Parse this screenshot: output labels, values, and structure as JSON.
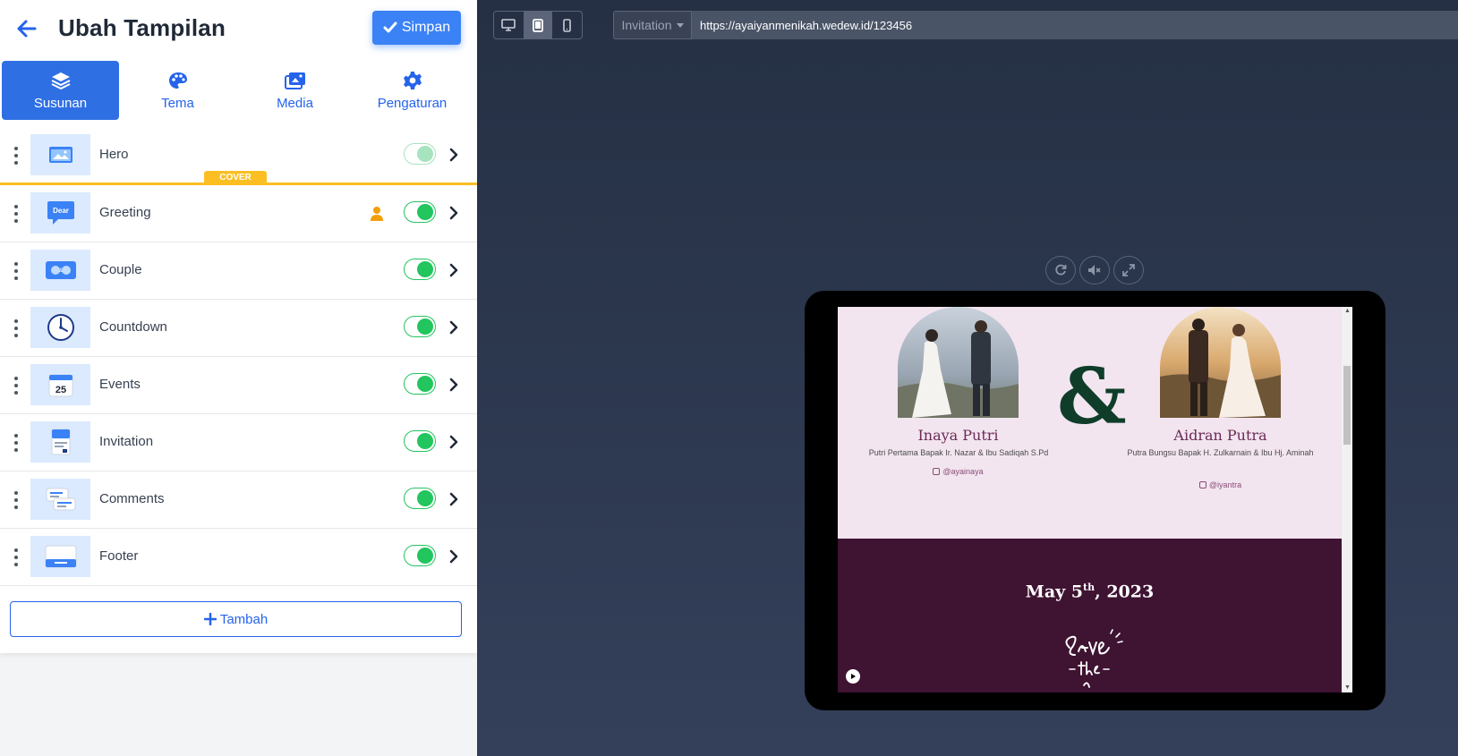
{
  "header": {
    "title": "Ubah Tampilan",
    "save_label": "Simpan"
  },
  "tabs": [
    {
      "label": "Susunan",
      "icon": "layers-icon",
      "active": true
    },
    {
      "label": "Tema",
      "icon": "palette-icon",
      "active": false
    },
    {
      "label": "Media",
      "icon": "images-icon",
      "active": false
    },
    {
      "label": "Pengaturan",
      "icon": "gear-icon",
      "active": false
    }
  ],
  "sections": [
    {
      "label": "Hero",
      "enabled": true,
      "badge": "COVER"
    },
    {
      "label": "Greeting",
      "enabled": true
    },
    {
      "label": "Couple",
      "enabled": true
    },
    {
      "label": "Countdown",
      "enabled": true
    },
    {
      "label": "Events",
      "enabled": true,
      "thumb_text": "25"
    },
    {
      "label": "Invitation",
      "enabled": true
    },
    {
      "label": "Comments",
      "enabled": true
    },
    {
      "label": "Footer",
      "enabled": true
    }
  ],
  "greeting_thumb_text": "Dear",
  "add_label": "Tambah",
  "preview": {
    "page_select": "Invitation",
    "url": "https://ayaiyanmenikah.wedew.id/123456",
    "device": "tablet",
    "bride": {
      "name": "Inaya Putri",
      "desc": "Putri Pertama Bapak Ir. Nazar & Ibu Sadiqah S.Pd",
      "instagram": "@ayainaya"
    },
    "groom": {
      "name": "Aidran Putra",
      "desc": "Putra Bungsu Bapak H. Zulkarnain & Ibu Hj. Aminah",
      "instagram": "@iyantra"
    },
    "ampersand": "&",
    "date_main": "May 5",
    "date_sup": "th",
    "date_year": ", 2023",
    "colors": {
      "accent": "#2f6fe4",
      "toggle_on": "#22c55e",
      "cover_badge": "#fbbf24",
      "couple_bg": "#f2e5ef",
      "date_bg": "#3f1332"
    }
  }
}
